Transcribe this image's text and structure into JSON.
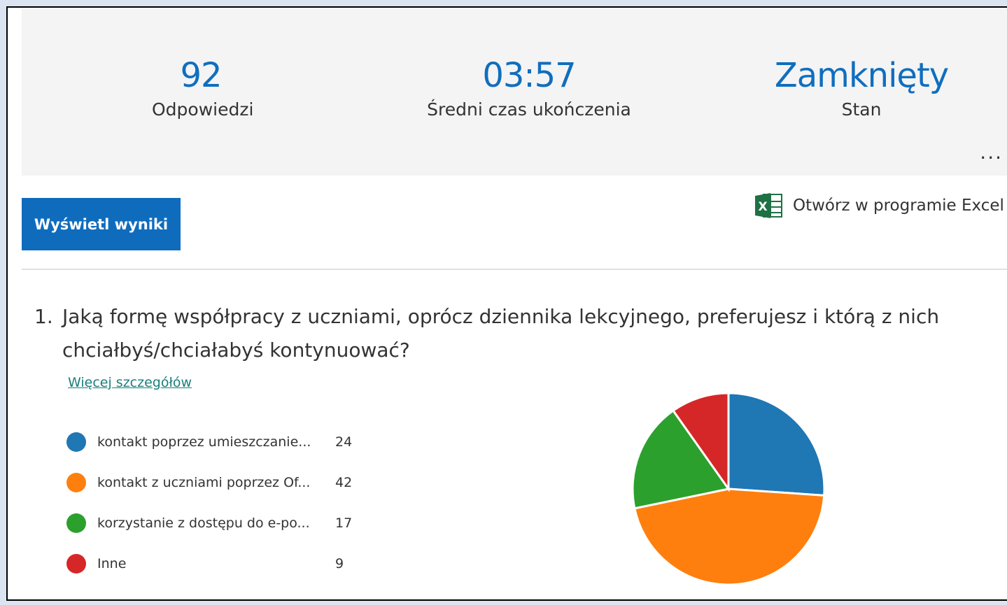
{
  "summary": {
    "responses": {
      "value": "92",
      "label": "Odpowiedzi"
    },
    "avg_time": {
      "value": "03:57",
      "label": "Średni czas ukończenia"
    },
    "status": {
      "value": "Zamknięty",
      "label": "Stan"
    },
    "more_label": "..."
  },
  "actions": {
    "view_results_label": "Wyświetl wyniki",
    "excel_label": "Otwórz w programie Excel"
  },
  "question": {
    "number": "1.",
    "text": "Jaką formę współpracy z uczniami, oprócz dziennika lekcyjnego, preferujesz i którą z nich chciałbyś/chciałabyś kontynuować?",
    "details_link": "Więcej szczegółów"
  },
  "chart_data": {
    "type": "pie",
    "series": [
      {
        "name": "kontakt poprzez umieszczanie...",
        "value": 24,
        "color": "#1f77b4"
      },
      {
        "name": "kontakt z uczniami poprzez Of...",
        "value": 42,
        "color": "#ff7f0e"
      },
      {
        "name": "korzystanie z dostępu do e-po...",
        "value": 17,
        "color": "#2ca02c"
      },
      {
        "name": "Inne",
        "value": 9,
        "color": "#d62728"
      }
    ]
  }
}
